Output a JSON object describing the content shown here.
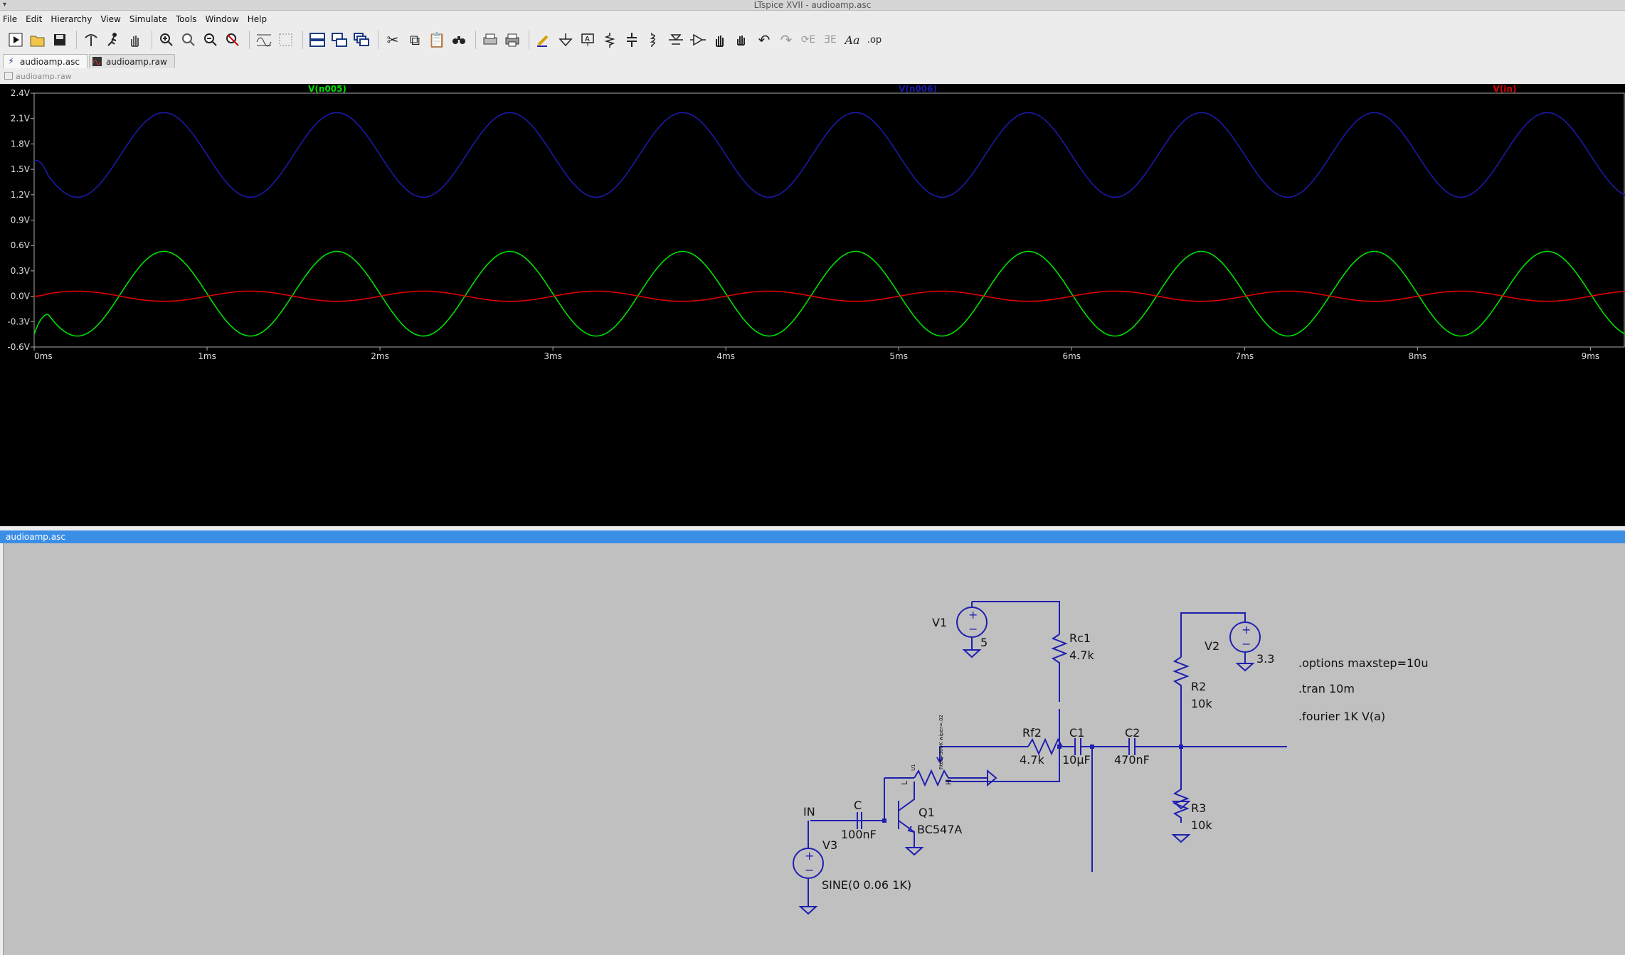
{
  "window": {
    "title": "LTspice XVII - audioamp.asc",
    "menu_glyph": "▾"
  },
  "menu": [
    "File",
    "Edit",
    "Hierarchy",
    "View",
    "Simulate",
    "Tools",
    "Window",
    "Help"
  ],
  "toolbar": {
    "groups": [
      [
        "run-icon",
        "open-icon",
        "save-icon"
      ],
      [
        "control-panel-icon",
        "halt-icon",
        "pan-icon"
      ],
      [
        "zoom-in-icon",
        "zoom-area-icon",
        "zoom-out-icon",
        "zoom-fit-icon"
      ],
      [
        "autorange-icon",
        "trace-icon"
      ],
      [
        "tile-horizontal-icon",
        "tile-vertical-icon",
        "cascade-icon"
      ],
      [
        "cut-icon",
        "copy-icon",
        "paste-icon",
        "find-icon"
      ],
      [
        "print-icon",
        "print-setup-icon"
      ],
      [
        "wire-icon",
        "ground-icon",
        "label-icon",
        "resistor-icon",
        "capacitor-icon",
        "inductor-icon",
        "diode-icon",
        "component-icon",
        "move-icon",
        "drag-icon",
        "undo-icon",
        "redo-icon",
        "rotate-icon",
        "mirror-icon",
        "text-icon",
        "spice-directive-icon"
      ]
    ],
    "text_button_aa": "Aa",
    "text_button_op": ".op"
  },
  "tabs": [
    {
      "label": "audioamp.asc",
      "icon": "schematic-icon",
      "active": true
    },
    {
      "label": "audioamp.raw",
      "icon": "waveform-icon",
      "active": false
    }
  ],
  "waveform_window": {
    "title": "audioamp.raw"
  },
  "schematic_window": {
    "title": "audioamp.asc"
  },
  "chart_data": {
    "type": "line",
    "title": "",
    "xlabel": "",
    "ylabel": "",
    "xlim": [
      0,
      9
    ],
    "ylim": [
      -0.6,
      2.4
    ],
    "x_unit": "ms",
    "y_ticks": [
      "2.4V",
      "2.1V",
      "1.8V",
      "1.5V",
      "1.2V",
      "0.9V",
      "0.6V",
      "0.3V",
      "0.0V",
      "-0.3V",
      "-0.6V"
    ],
    "x_ticks": [
      "0ms",
      "1ms",
      "2ms",
      "3ms",
      "4ms",
      "5ms",
      "6ms",
      "7ms",
      "8ms",
      "9ms"
    ],
    "grid": false,
    "legend_placement": "top",
    "series": [
      {
        "name": "V(n005)",
        "color": "#00e000",
        "offset": 0.03,
        "amplitude": 0.5,
        "frequency_khz": 1,
        "phase": "inverted",
        "start_value": -0.45
      },
      {
        "name": "V(n006)",
        "color": "#1a1aa8",
        "offset": 1.67,
        "amplitude": 0.5,
        "frequency_khz": 1,
        "phase": "inverted",
        "start_value": 1.6
      },
      {
        "name": "V(in)",
        "color": "#e00000",
        "offset": 0.0,
        "amplitude": 0.06,
        "frequency_khz": 1,
        "phase": "normal",
        "start_value": 0.0
      }
    ]
  },
  "schematic": {
    "components": {
      "v1_name": "V1",
      "v1_value": "5",
      "rc1_name": "Rc1",
      "rc1_value": "4.7k",
      "v2_name": "V2",
      "v2_value": "3.3",
      "r2_name": "R2",
      "r2_value": "10k",
      "r3_name": "R3",
      "r3_value": "10k",
      "rf2_name": "Rf2",
      "rf2_value": "4.7k",
      "c1_name": "C1",
      "c1_value": "10µF",
      "c2_name": "C2",
      "c2_value": "470nF",
      "c_name": "C",
      "c_value": "100nF",
      "q1_name": "Q1",
      "q1_value": "BC547A",
      "v3_name": "V3",
      "v3_value": "SINE(0 0.06 1K)",
      "in_label": "IN",
      "u1_name": "U1",
      "pot_param": "Rtot=500K wiper=.02",
      "pot_l": "L",
      "pot_h": "H"
    },
    "directives": [
      ".options maxstep=10u",
      ".tran 10m",
      ".fourier 1K V(a)"
    ],
    "wire_color": "#1f1fb0",
    "text_color": "#111111"
  }
}
